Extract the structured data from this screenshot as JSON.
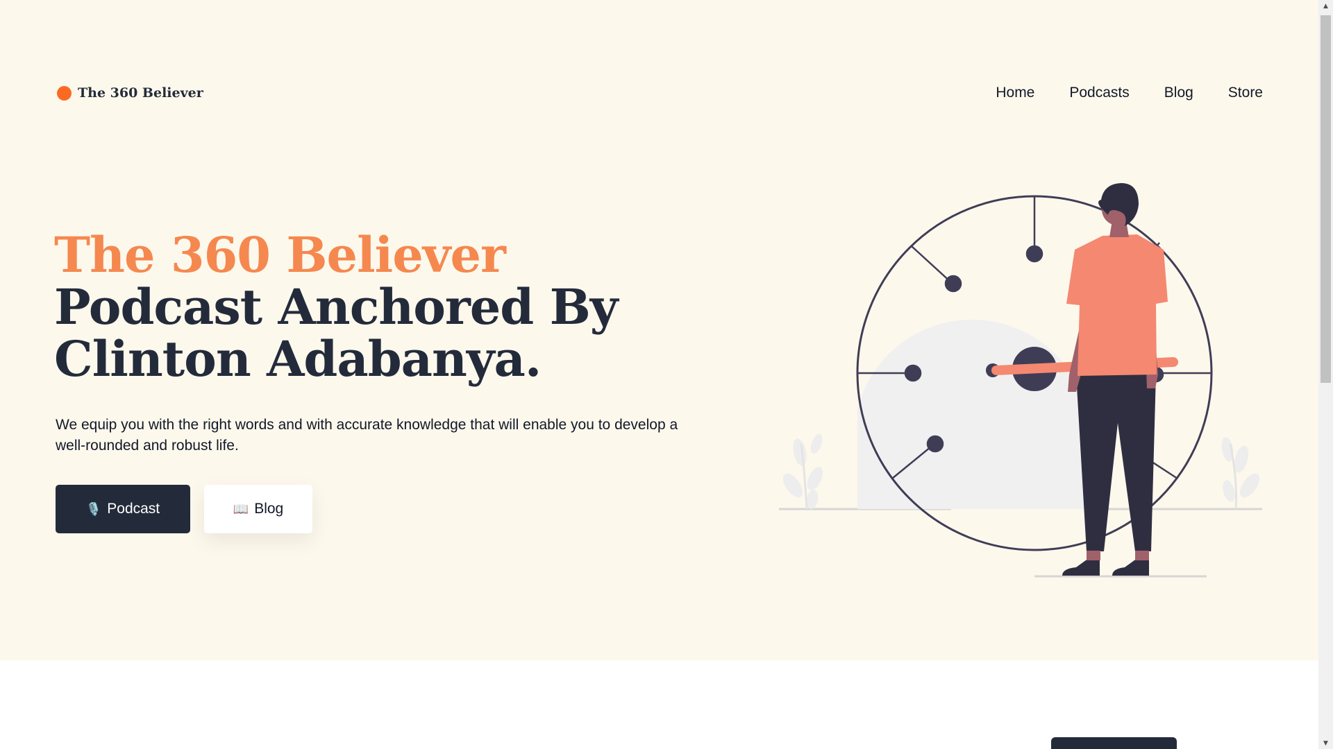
{
  "header": {
    "brand": "The 360 Believer",
    "nav": [
      {
        "label": "Home"
      },
      {
        "label": "Podcasts"
      },
      {
        "label": "Blog"
      },
      {
        "label": "Store"
      }
    ]
  },
  "hero": {
    "title_accent": "The 360 Believer",
    "title_rest": " Podcast Anchored By Clinton Adabanya.",
    "subtitle": "We equip you with the right words and with accurate knowledge that will enable you to develop a well-rounded and robust life.",
    "buttons": {
      "podcast": {
        "icon": "🎙️",
        "label": "Podcast"
      },
      "blog": {
        "icon": "📖",
        "label": "Blog"
      }
    }
  },
  "colors": {
    "background": "#fdf8ec",
    "accent": "#f5884f",
    "dark": "#232b3b",
    "brand_dot": "#fb6a22",
    "figure_shirt": "#f58870"
  },
  "scrollbar": {
    "up_icon": "triangle-up",
    "down_icon": "triangle-down"
  }
}
